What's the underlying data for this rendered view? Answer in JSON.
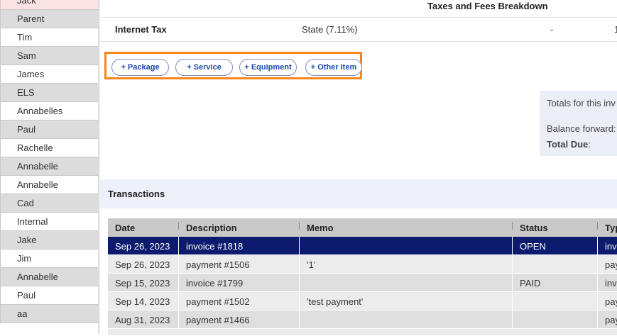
{
  "left_list": [
    "Jack",
    "Parent",
    "Tim",
    "Sam",
    "James",
    "ELS",
    "Annabelles",
    "Paul",
    "Rachelle",
    "Annabelle",
    "Annabelle",
    "Cad",
    "Internal",
    "Jake",
    "Jim",
    "Annabelle",
    "Paul",
    "aa"
  ],
  "taxes": {
    "header": "Taxes and Fees Breakdown",
    "row": {
      "name": "Internet Tax",
      "rate": "State (7.11%)",
      "dash": "-",
      "amount": "1"
    }
  },
  "add_buttons": [
    "+ Package",
    "+ Service",
    "+ Equipment",
    "+ Other Item"
  ],
  "totals": {
    "title": "Totals for this inv",
    "balance_forward": "Balance forward:",
    "total_due_label": "Total Due",
    "total_due_colon": ":"
  },
  "transactions": {
    "title": "Transactions",
    "columns": [
      "Date",
      "Description",
      "Memo",
      "Status",
      "Typ"
    ],
    "rows": [
      {
        "date": "Sep 26, 2023",
        "description": "invoice #1818",
        "memo": "",
        "status": "OPEN",
        "type": "inv"
      },
      {
        "date": "Sep 26, 2023",
        "description": "payment #1506",
        "memo": "'1'",
        "status": "",
        "type": "pay"
      },
      {
        "date": "Sep 15, 2023",
        "description": "invoice #1799",
        "memo": "",
        "status": "PAID",
        "type": "inv"
      },
      {
        "date": "Sep 14, 2023",
        "description": "payment #1502",
        "memo": "'test payment'",
        "status": "",
        "type": "pay"
      },
      {
        "date": "Aug 31, 2023",
        "description": "payment #1466",
        "memo": "",
        "status": "",
        "type": "pay"
      }
    ]
  },
  "colors": {
    "accent_orange": "#f7871c",
    "selected_row": "#0c1b6e",
    "button_text": "#1a49b0"
  }
}
